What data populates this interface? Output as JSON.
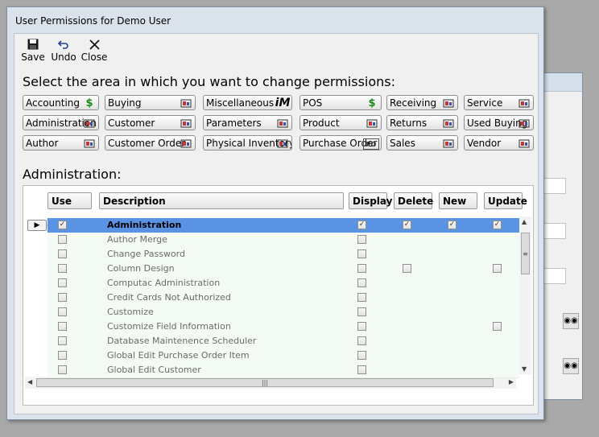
{
  "window": {
    "title": "User Permissions for Demo User"
  },
  "toolbar": [
    {
      "label": "Save",
      "icon": "save-icon"
    },
    {
      "label": "Undo",
      "icon": "undo-icon"
    },
    {
      "label": "Close",
      "icon": "close-icon"
    }
  ],
  "heading": "Select the area in which you want to change permissions:",
  "areas": [
    [
      "Accounting",
      "Buying",
      "Miscellaneous",
      "POS",
      "Receiving",
      "Service"
    ],
    [
      "Administration",
      "Customer",
      "Parameters",
      "Product",
      "Returns",
      "Used Buying"
    ],
    [
      "Author",
      "Customer Order",
      "Physical Inventory",
      "Purchase Order",
      "Sales",
      "Vendor"
    ]
  ],
  "area_icons": {
    "Accounting": "$",
    "POS": "$",
    "Miscellaneous": "iM",
    "Purchase Order": "PO"
  },
  "selected_area": "Administration:",
  "columns": [
    "Use",
    "Description",
    "Display",
    "Delete",
    "New",
    "Update"
  ],
  "rows": [
    {
      "desc": "Administration",
      "use": true,
      "display": true,
      "delete": true,
      "new": true,
      "update": true,
      "selected": true
    },
    {
      "desc": "Author Merge",
      "use": false,
      "display": false
    },
    {
      "desc": "Change Password",
      "use": false,
      "display": false
    },
    {
      "desc": "Column Design",
      "use": false,
      "display": false,
      "delete": false,
      "update": false
    },
    {
      "desc": "Computac Administration",
      "use": false,
      "display": false
    },
    {
      "desc": "Credit Cards Not Authorized",
      "use": false,
      "display": false
    },
    {
      "desc": "Customize",
      "use": false,
      "display": false
    },
    {
      "desc": "Customize Field Information",
      "use": false,
      "display": false,
      "update": false
    },
    {
      "desc": "Database Maintenence Scheduler",
      "use": false,
      "display": false
    },
    {
      "desc": "Global Edit Purchase Order Item",
      "use": false,
      "display": false
    },
    {
      "desc": "Global Edit Customer",
      "use": false,
      "display": false
    }
  ]
}
